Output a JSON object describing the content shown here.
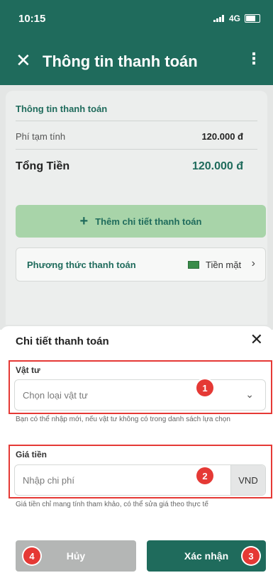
{
  "status_bar": {
    "time": "10:15",
    "network": "4G"
  },
  "header": {
    "title": "Thông tin thanh toán",
    "close_icon": "close-icon",
    "menu_icon": "more-vertical-icon"
  },
  "summary": {
    "section_title": "Thông tin thanh toán",
    "fee_label": "Phí tạm tính",
    "fee_value": "120.000 đ",
    "total_label": "Tổng Tiền",
    "total_value": "120.000 đ"
  },
  "add_button": {
    "label": "Thêm chi tiết thanh toán",
    "icon": "plus-icon"
  },
  "payment_method": {
    "label": "Phương thức thanh toán",
    "value": "Tiền mặt",
    "icon": "cash-icon"
  },
  "sheet": {
    "title": "Chi tiết thanh toán",
    "material": {
      "label": "Vật tư",
      "placeholder": "Chọn loại vật tư",
      "hint": "Bạn có thể nhập mới, nếu vật tư không có trong danh sách lựa chọn",
      "badge": "1"
    },
    "price": {
      "label": "Giá tiền",
      "placeholder": "Nhập chi phí",
      "unit": "VND",
      "hint": "Giá tiền chỉ mang tính tham khảo, có thể sửa giá theo thực tế",
      "badge": "2"
    },
    "cancel_label": "Hủy",
    "cancel_badge": "4",
    "confirm_label": "Xác nhận",
    "confirm_badge": "3"
  },
  "colors": {
    "primary": "#1f6b5c",
    "accent_green": "#a8d4a9",
    "annotation_red": "#e53935"
  }
}
